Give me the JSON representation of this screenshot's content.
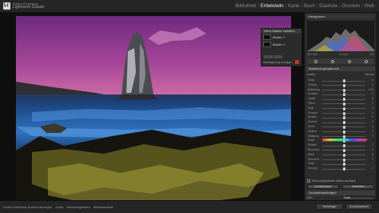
{
  "app": {
    "brand_line1": "Adobe Photoshop",
    "brand_line2": "Lightroom Classic"
  },
  "modules": [
    "Bibliothek",
    "Entwickeln",
    "Karte",
    "Buch",
    "Diashow",
    "Drucken",
    "Web"
  ],
  "active_module": "Entwickeln",
  "navigator": {
    "title": "Neue Maske erstellen",
    "item_label": "Maske 1",
    "sub_label": "Maske 1",
    "footer": "Überlagerung anzeigen"
  },
  "histogram_panel": {
    "title": "Histogramm",
    "meta_left": "ISO 100",
    "meta_mid": "24 mm",
    "meta_right": "f/11"
  },
  "masking_panel": {
    "title": "Maskierungsoptionen",
    "mask_label": "Maske:",
    "mask_value": "Himmel"
  },
  "sliders": [
    {
      "label": "Temp",
      "value": "0",
      "pos": 0.5
    },
    {
      "label": "Tönung",
      "value": "0",
      "pos": 0.5
    },
    {
      "label": "Belichtung",
      "value": "0,00",
      "pos": 0.5
    },
    {
      "label": "Kontrast",
      "value": "0",
      "pos": 0.5
    },
    {
      "label": "Lichter",
      "value": "0",
      "pos": 0.5
    },
    {
      "label": "Tiefen",
      "value": "0",
      "pos": 0.5
    },
    {
      "label": "Weiß",
      "value": "0",
      "pos": 0.5
    },
    {
      "label": "Schwarz",
      "value": "0",
      "pos": 0.5
    },
    {
      "label": "Struktur",
      "value": "0",
      "pos": 0.5
    },
    {
      "label": "Klarheit",
      "value": "0",
      "pos": 0.5
    },
    {
      "label": "Dunst",
      "value": "0",
      "pos": 0.5
    },
    {
      "label": "Farbton",
      "value": "0",
      "pos": 0.5
    },
    {
      "label": "Sättigung",
      "value": "0",
      "pos": 0.5
    },
    {
      "label": "Farbe",
      "value": "",
      "pos": 0.5
    },
    {
      "label": "Schärfe",
      "value": "0",
      "pos": 0.5
    },
    {
      "label": "Rauschen",
      "value": "0",
      "pos": 0.5
    },
    {
      "label": "Moiré",
      "value": "0",
      "pos": 0.5
    },
    {
      "label": "Rand entf.",
      "value": "0",
      "pos": 0.5
    },
    {
      "label": "Farbe",
      "value": "",
      "pos": 0.5
    },
    {
      "label": "Körnung",
      "value": "0",
      "pos": 0.5
    }
  ],
  "options": {
    "checkbox_label": "Nicht ausgewählte Maske anzeigen",
    "button_left": "Zurücksetzen",
    "button_right": "Schließen"
  },
  "basic_panel": {
    "title": "Grundeinstellungen",
    "row1_label": "Beh.:",
    "row1_value": "Farbe",
    "row2_label": "Profil:",
    "row2_value": "Adobe Farbe",
    "row3_label": "WA:",
    "row3_value": "Wie Aufnahme"
  },
  "bottom": {
    "item1": "Vorher-/Nachher-Ansicht anzeigen",
    "item2": "Zoom",
    "item3": "Werkzeugleisten",
    "item4": "Bildausschnitt",
    "btn_prev": "Vorherige",
    "btn_reset": "Zurücksetzen"
  },
  "colors": {
    "sky_top": "#7a2f86",
    "sky_bottom": "#d46aa6",
    "water": "#1e5aa0",
    "accent_red": "#c7332b"
  }
}
